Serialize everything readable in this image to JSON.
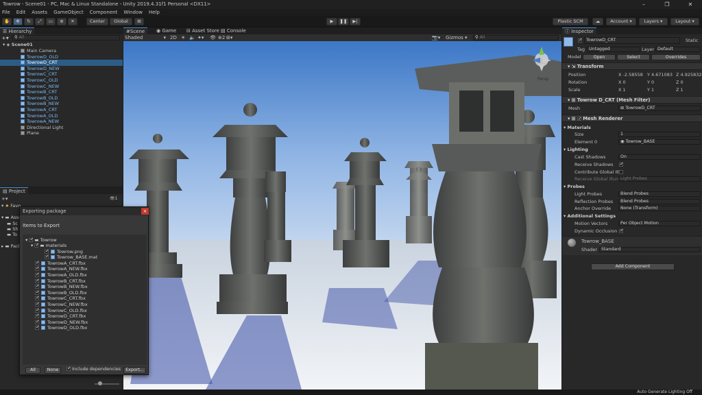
{
  "window": {
    "title": "Towrow - Scene01 - PC, Mac & Linux Standalone - Unity 2019.4.31f1 Personal <DX11>",
    "controls": [
      "–",
      "❐",
      "✕"
    ]
  },
  "menu": [
    "File",
    "Edit",
    "Assets",
    "GameObject",
    "Component",
    "Window",
    "Help"
  ],
  "toolbar": {
    "center_label": "Center",
    "global_label": "Global",
    "plastic_label": "Plastic SCM",
    "account_label": "Account",
    "layers_label": "Layers",
    "layout_label": "Layout"
  },
  "hierarchy": {
    "tab_label": "Hierarchy",
    "search_placeholder": "All",
    "scene": "Scene01",
    "items": [
      {
        "label": "Main Camera",
        "prefab": false
      },
      {
        "label": "TowrowD_OLD",
        "prefab": true
      },
      {
        "label": "TowrowD_CRT",
        "prefab": true,
        "selected": true
      },
      {
        "label": "TowrowD_NEW",
        "prefab": true
      },
      {
        "label": "TowrowC_CRT",
        "prefab": true
      },
      {
        "label": "TowrowC_OLD",
        "prefab": true
      },
      {
        "label": "TowrowC_NEW",
        "prefab": true
      },
      {
        "label": "TowrowB_CRT",
        "prefab": true
      },
      {
        "label": "TowrowB_OLD",
        "prefab": true
      },
      {
        "label": "TowrowB_NEW",
        "prefab": true
      },
      {
        "label": "TowrowA_CRT",
        "prefab": true
      },
      {
        "label": "TowrowA_OLD",
        "prefab": true
      },
      {
        "label": "TowrowA_NEW",
        "prefab": true
      },
      {
        "label": "Directional Light",
        "prefab": false
      },
      {
        "label": "Plane",
        "prefab": false
      }
    ]
  },
  "project": {
    "tab_label": "Project",
    "favorites_label": "Favo",
    "assets_label": "Asse",
    "items": [
      "Sc",
      "Sh",
      "To"
    ],
    "packages_label": "Pack",
    "count": "1"
  },
  "export_dialog": {
    "title": "Exporting package",
    "heading": "Items to Export",
    "root": "Towrow",
    "folder": "materials",
    "files": [
      "Towrow.png",
      "Towrow_BASE.mat",
      "TowrowA_CRT.fbx",
      "TowrowA_NEW.fbx",
      "TowrowA_OLD.fbx",
      "TowrowB_CRT.fbx",
      "TowrowB_NEW.fbx",
      "TowrowB_OLD.fbx",
      "TowrowC_CRT.fbx",
      "TowrowC_NEW.fbx",
      "TowrowC_OLD.fbx",
      "TowrowD_CRT.fbx",
      "TowrowD_NEW.fbx",
      "TowrowD_OLD.fbx"
    ],
    "all_label": "All",
    "none_label": "None",
    "include_deps_label": "Include dependencies",
    "export_label": "Export..."
  },
  "scene_view": {
    "tabs": [
      "Scene",
      "Game",
      "Asset Store",
      "Console"
    ],
    "shading": "Shaded",
    "mode_2d": "2D",
    "gizmos_label": "Gizmos",
    "gizmo_count": "2",
    "search_placeholder": "All",
    "persp_label": "Persp"
  },
  "inspector": {
    "tab_label": "Inspector",
    "object_name": "TowrowD_CRT",
    "static_label": "Static",
    "tag_label": "Tag",
    "tag_value": "Untagged",
    "layer_label": "Layer",
    "layer_value": "Default",
    "model_label": "Model",
    "open_label": "Open",
    "select_label": "Select",
    "overrides_label": "Overrides",
    "transform": {
      "header": "Transform",
      "position_label": "Position",
      "rotation_label": "Rotation",
      "scale_label": "Scale",
      "position": [
        "X -2.58558",
        "Y 4.671083",
        "Z 4.925832"
      ],
      "rotation": [
        "X 0",
        "Y 0",
        "Z 0"
      ],
      "scale": [
        "X 1",
        "Y 1",
        "Z 1"
      ]
    },
    "mesh_filter": {
      "header": "Towrow D_CRT (Mesh Filter)",
      "mesh_label": "Mesh",
      "mesh_value": "TowrowD_CRT"
    },
    "mesh_renderer": {
      "header": "Mesh Renderer",
      "materials_label": "Materials",
      "size_label": "Size",
      "size_value": "1",
      "element_label": "Element 0",
      "element_value": "Towrow_BASE",
      "lighting_label": "Lighting",
      "cast_shadows_label": "Cast Shadows",
      "cast_shadows_value": "On",
      "receive_shadows_label": "Receive Shadows",
      "contribute_gi_label": "Contribute Global Illu",
      "receive_gi_label": "Receive Global Illumi",
      "receive_gi_value": "Light Probes",
      "probes_label": "Probes",
      "light_probes_label": "Light Probes",
      "light_probes_value": "Blend Probes",
      "reflection_probes_label": "Reflection Probes",
      "reflection_probes_value": "Blend Probes",
      "anchor_override_label": "Anchor Override",
      "anchor_override_value": "None (Transform)",
      "additional_label": "Additional Settings",
      "motion_vectors_label": "Motion Vectors",
      "motion_vectors_value": "Per Object Motion",
      "dynamic_occlusion_label": "Dynamic Occlusion"
    },
    "material": {
      "name": "Towrow_BASE",
      "shader_label": "Shader",
      "shader_value": "Standard"
    },
    "add_component_label": "Add Component"
  },
  "status": {
    "right_text": "Auto Generate Lighting Off"
  },
  "colors": {
    "accent": "#4a8fd4",
    "prefab_text": "#7eb8f0",
    "sky_top": "#3d78c8",
    "sky_bottom": "#a9c6ea"
  }
}
